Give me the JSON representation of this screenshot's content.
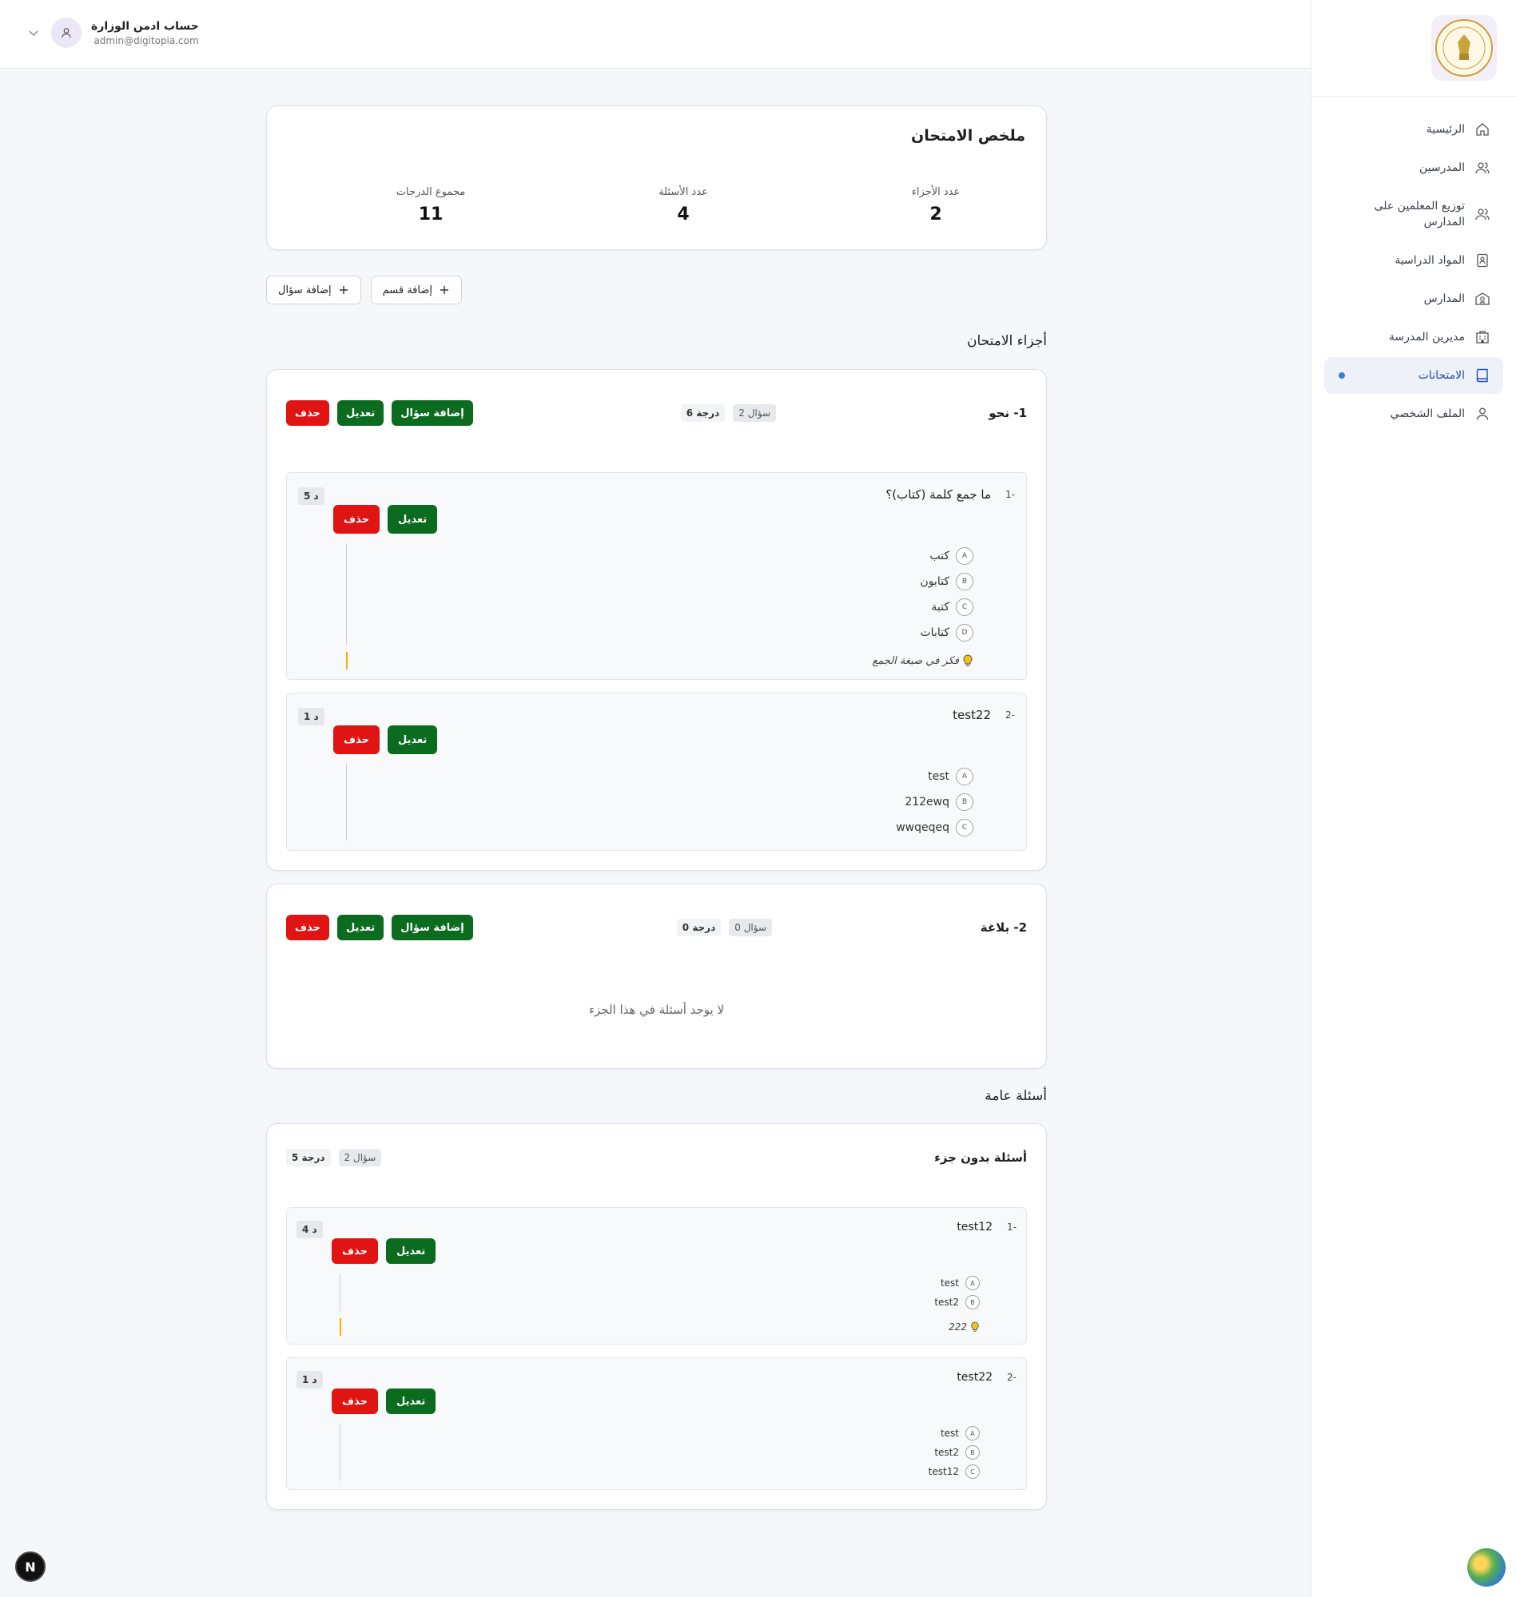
{
  "sidebar": {
    "items": [
      {
        "label": "الرئيسية",
        "icon": "home-icon"
      },
      {
        "label": "المدرسين",
        "icon": "users-icon"
      },
      {
        "label": "توزيع المعلمين على المدارس",
        "icon": "users-icon"
      },
      {
        "label": "المواد الدراسية",
        "icon": "book-badge-icon"
      },
      {
        "label": "المدارس",
        "icon": "school-icon"
      },
      {
        "label": "مديرين المدرسة",
        "icon": "building-icon"
      },
      {
        "label": "الامتحانات",
        "icon": "book-icon",
        "active": true
      },
      {
        "label": "الملف الشخصي",
        "icon": "user-icon"
      }
    ]
  },
  "header": {
    "account_name": "حساب ادمن الوزارة",
    "account_email": "admin@digitopia.com"
  },
  "summary": {
    "title": "ملخص الامتحان",
    "stats": [
      {
        "label": "عدد الأجزاء",
        "value": "2"
      },
      {
        "label": "عدد الأسئلة",
        "value": "4"
      },
      {
        "label": "مجموع الدرجات",
        "value": "11"
      }
    ]
  },
  "actions": {
    "add_section": "إضافة قسم",
    "add_question": "إضافة سؤال"
  },
  "parts_title": "أجزاء الامتحان",
  "buttons": {
    "add_question": "إضافة سؤال",
    "edit": "تعديل",
    "delete": "حذف"
  },
  "parts": [
    {
      "title": "1- نحو",
      "questions_count": "2 سؤال",
      "degrees": "6 درجة",
      "questions": [
        {
          "num": "-1",
          "text": "ما جمع كلمة (كتاب)؟",
          "minutes": "5 د",
          "options": [
            {
              "letter": "A",
              "text": "كتب"
            },
            {
              "letter": "B",
              "text": "كتابون"
            },
            {
              "letter": "C",
              "text": "كتبة"
            },
            {
              "letter": "D",
              "text": "كتابات"
            }
          ],
          "hint": "فكر في صيغة الجمع"
        },
        {
          "num": "-2",
          "text": "test22",
          "minutes": "1 د",
          "options": [
            {
              "letter": "A",
              "text": "test"
            },
            {
              "letter": "B",
              "text": "212ewq"
            },
            {
              "letter": "C",
              "text": "wwqeqeq"
            }
          ]
        }
      ]
    },
    {
      "title": "2- بلاغة",
      "questions_count": "0 سؤال",
      "degrees": "0 درجة",
      "empty_text": "لا يوجد أسئلة في هذا الجزء"
    }
  ],
  "general": {
    "section_title": "أسئلة عامة",
    "card_title": "أسئلة بدون جزء",
    "questions_count": "2 سؤال",
    "degrees": "5 درجة",
    "questions": [
      {
        "num": "-1",
        "text": "test12",
        "minutes": "4 د",
        "options": [
          {
            "letter": "A",
            "text": "test"
          },
          {
            "letter": "B",
            "text": "test2"
          }
        ],
        "hint": "222"
      },
      {
        "num": "-2",
        "text": "test22",
        "minutes": "1 د",
        "options": [
          {
            "letter": "A",
            "text": "test"
          },
          {
            "letter": "B",
            "text": "test2"
          },
          {
            "letter": "C",
            "text": "test12"
          }
        ]
      }
    ]
  },
  "fab_letter": "N"
}
